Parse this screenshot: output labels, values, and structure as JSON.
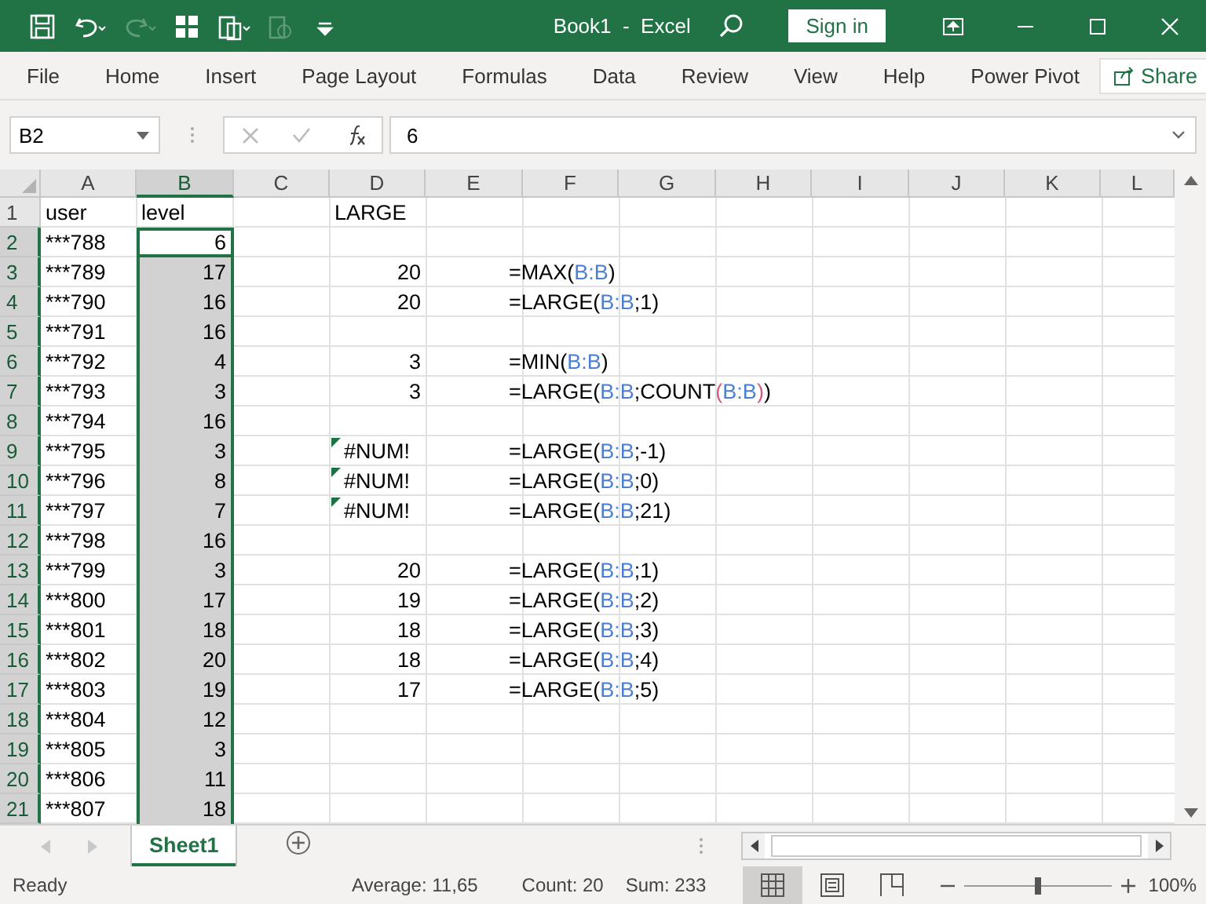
{
  "title_bar": {
    "quick_access": [
      {
        "kind": "save",
        "disabled": false
      },
      {
        "kind": "undo",
        "disabled": false
      },
      {
        "kind": "redo",
        "disabled": true
      },
      {
        "kind": "table",
        "disabled": false
      },
      {
        "kind": "paste",
        "disabled": false
      },
      {
        "kind": "paste_special",
        "disabled": true
      },
      {
        "kind": "customize",
        "disabled": false
      }
    ],
    "title": "Book1  -  Excel",
    "sign_in": "Sign in"
  },
  "ribbon_tabs": [
    {
      "label": "File"
    },
    {
      "label": "Home"
    },
    {
      "label": "Insert"
    },
    {
      "label": "Page Layout"
    },
    {
      "label": "Formulas"
    },
    {
      "label": "Data"
    },
    {
      "label": "Review"
    },
    {
      "label": "View"
    },
    {
      "label": "Help"
    },
    {
      "label": "Power Pivot"
    }
  ],
  "share": "Share",
  "formula_bar": {
    "name_box": "B2",
    "value": "6"
  },
  "columns": [
    {
      "label": "A",
      "selected": false
    },
    {
      "label": "B",
      "selected": true
    },
    {
      "label": "C",
      "selected": false
    },
    {
      "label": "D",
      "selected": false
    },
    {
      "label": "E",
      "selected": false
    },
    {
      "label": "F",
      "selected": false
    },
    {
      "label": "G",
      "selected": false
    },
    {
      "label": "H",
      "selected": false
    },
    {
      "label": "I",
      "selected": false
    },
    {
      "label": "J",
      "selected": false
    },
    {
      "label": "K",
      "selected": false
    },
    {
      "label": "L",
      "selected": false
    }
  ],
  "rows": [
    {
      "number": "1",
      "selected": false,
      "column_a": {
        "kind": "text",
        "text": "user"
      },
      "column_b": {
        "kind": "text",
        "text": "level",
        "selected": false
      },
      "column_d": {
        "kind": "text",
        "text": "LARGE"
      }
    },
    {
      "number": "2",
      "selected": true,
      "column_a": {
        "kind": "text",
        "text": "***788"
      },
      "column_b": {
        "kind": "number",
        "text": "6",
        "active": true
      }
    },
    {
      "number": "3",
      "selected": true,
      "column_a": {
        "kind": "text",
        "text": "***789"
      },
      "column_b": {
        "kind": "number",
        "text": "17",
        "selected": true
      },
      "column_d": {
        "kind": "number",
        "text": "20"
      },
      "column_f": {
        "kind": "formula",
        "segments": [
          {
            "text": "=MAX(",
            "color": "#000000"
          },
          {
            "text": "B:B",
            "color": "#4a7fd4"
          },
          {
            "text": ")",
            "color": "#000000"
          }
        ]
      }
    },
    {
      "number": "4",
      "selected": true,
      "column_a": {
        "kind": "text",
        "text": "***790"
      },
      "column_b": {
        "kind": "number",
        "text": "16",
        "selected": true
      },
      "column_d": {
        "kind": "number",
        "text": "20"
      },
      "column_f": {
        "kind": "formula",
        "segments": [
          {
            "text": "=LARGE(",
            "color": "#000000"
          },
          {
            "text": "B:B",
            "color": "#4a7fd4"
          },
          {
            "text": ";1)",
            "color": "#000000"
          }
        ]
      }
    },
    {
      "number": "5",
      "selected": true,
      "column_a": {
        "kind": "text",
        "text": "***791"
      },
      "column_b": {
        "kind": "number",
        "text": "16",
        "selected": true
      }
    },
    {
      "number": "6",
      "selected": true,
      "column_a": {
        "kind": "text",
        "text": "***792"
      },
      "column_b": {
        "kind": "number",
        "text": "4",
        "selected": true
      },
      "column_d": {
        "kind": "number",
        "text": "3"
      },
      "column_f": {
        "kind": "formula",
        "segments": [
          {
            "text": "=MIN(",
            "color": "#000000"
          },
          {
            "text": "B:B",
            "color": "#4a7fd4"
          },
          {
            "text": ")",
            "color": "#000000"
          }
        ]
      }
    },
    {
      "number": "7",
      "selected": true,
      "column_a": {
        "kind": "text",
        "text": "***793"
      },
      "column_b": {
        "kind": "number",
        "text": "3",
        "selected": true
      },
      "column_d": {
        "kind": "number",
        "text": "3"
      },
      "column_f": {
        "kind": "formula",
        "segments": [
          {
            "text": "=LARGE(",
            "color": "#000000"
          },
          {
            "text": "B:B",
            "color": "#4a7fd4"
          },
          {
            "text": ";COUNT",
            "color": "#000000"
          },
          {
            "text": "(",
            "color": "#d35b83"
          },
          {
            "text": "B:B",
            "color": "#4a7fd4"
          },
          {
            "text": ")",
            "color": "#d35b83"
          },
          {
            "text": ")",
            "color": "#000000"
          }
        ]
      }
    },
    {
      "number": "8",
      "selected": true,
      "column_a": {
        "kind": "text",
        "text": "***794"
      },
      "column_b": {
        "kind": "number",
        "text": "16",
        "selected": true
      }
    },
    {
      "number": "9",
      "selected": true,
      "column_a": {
        "kind": "text",
        "text": "***795"
      },
      "column_b": {
        "kind": "number",
        "text": "3",
        "selected": true
      },
      "column_d": {
        "kind": "error",
        "text": "#NUM!"
      },
      "column_f": {
        "kind": "formula",
        "segments": [
          {
            "text": "=LARGE(",
            "color": "#000000"
          },
          {
            "text": "B:B",
            "color": "#4a7fd4"
          },
          {
            "text": ";-1)",
            "color": "#000000"
          }
        ]
      }
    },
    {
      "number": "10",
      "selected": true,
      "column_a": {
        "kind": "text",
        "text": "***796"
      },
      "column_b": {
        "kind": "number",
        "text": "8",
        "selected": true
      },
      "column_d": {
        "kind": "error",
        "text": "#NUM!"
      },
      "column_f": {
        "kind": "formula",
        "segments": [
          {
            "text": "=LARGE(",
            "color": "#000000"
          },
          {
            "text": "B:B",
            "color": "#4a7fd4"
          },
          {
            "text": ";0)",
            "color": "#000000"
          }
        ]
      }
    },
    {
      "number": "11",
      "selected": true,
      "column_a": {
        "kind": "text",
        "text": "***797"
      },
      "column_b": {
        "kind": "number",
        "text": "7",
        "selected": true
      },
      "column_d": {
        "kind": "error",
        "text": "#NUM!"
      },
      "column_f": {
        "kind": "formula",
        "segments": [
          {
            "text": "=LARGE(",
            "color": "#000000"
          },
          {
            "text": "B:B",
            "color": "#4a7fd4"
          },
          {
            "text": ";21)",
            "color": "#000000"
          }
        ]
      }
    },
    {
      "number": "12",
      "selected": true,
      "column_a": {
        "kind": "text",
        "text": "***798"
      },
      "column_b": {
        "kind": "number",
        "text": "16",
        "selected": true
      }
    },
    {
      "number": "13",
      "selected": true,
      "column_a": {
        "kind": "text",
        "text": "***799"
      },
      "column_b": {
        "kind": "number",
        "text": "3",
        "selected": true
      },
      "column_d": {
        "kind": "number",
        "text": "20"
      },
      "column_f": {
        "kind": "formula",
        "segments": [
          {
            "text": "=LARGE(",
            "color": "#000000"
          },
          {
            "text": "B:B",
            "color": "#4a7fd4"
          },
          {
            "text": ";1)",
            "color": "#000000"
          }
        ]
      }
    },
    {
      "number": "14",
      "selected": true,
      "column_a": {
        "kind": "text",
        "text": "***800"
      },
      "column_b": {
        "kind": "number",
        "text": "17",
        "selected": true
      },
      "column_d": {
        "kind": "number",
        "text": "19"
      },
      "column_f": {
        "kind": "formula",
        "segments": [
          {
            "text": "=LARGE(",
            "color": "#000000"
          },
          {
            "text": "B:B",
            "color": "#4a7fd4"
          },
          {
            "text": ";2)",
            "color": "#000000"
          }
        ]
      }
    },
    {
      "number": "15",
      "selected": true,
      "column_a": {
        "kind": "text",
        "text": "***801"
      },
      "column_b": {
        "kind": "number",
        "text": "18",
        "selected": true
      },
      "column_d": {
        "kind": "number",
        "text": "18"
      },
      "column_f": {
        "kind": "formula",
        "segments": [
          {
            "text": "=LARGE(",
            "color": "#000000"
          },
          {
            "text": "B:B",
            "color": "#4a7fd4"
          },
          {
            "text": ";3)",
            "color": "#000000"
          }
        ]
      }
    },
    {
      "number": "16",
      "selected": true,
      "column_a": {
        "kind": "text",
        "text": "***802"
      },
      "column_b": {
        "kind": "number",
        "text": "20",
        "selected": true
      },
      "column_d": {
        "kind": "number",
        "text": "18"
      },
      "column_f": {
        "kind": "formula",
        "segments": [
          {
            "text": "=LARGE(",
            "color": "#000000"
          },
          {
            "text": "B:B",
            "color": "#4a7fd4"
          },
          {
            "text": ";4)",
            "color": "#000000"
          }
        ]
      }
    },
    {
      "number": "17",
      "selected": true,
      "column_a": {
        "kind": "text",
        "text": "***803"
      },
      "column_b": {
        "kind": "number",
        "text": "19",
        "selected": true
      },
      "column_d": {
        "kind": "number",
        "text": "17"
      },
      "column_f": {
        "kind": "formula",
        "segments": [
          {
            "text": "=LARGE(",
            "color": "#000000"
          },
          {
            "text": "B:B",
            "color": "#4a7fd4"
          },
          {
            "text": ";5)",
            "color": "#000000"
          }
        ]
      }
    },
    {
      "number": "18",
      "selected": true,
      "column_a": {
        "kind": "text",
        "text": "***804"
      },
      "column_b": {
        "kind": "number",
        "text": "12",
        "selected": true
      }
    },
    {
      "number": "19",
      "selected": true,
      "column_a": {
        "kind": "text",
        "text": "***805"
      },
      "column_b": {
        "kind": "number",
        "text": "3",
        "selected": true
      }
    },
    {
      "number": "20",
      "selected": true,
      "column_a": {
        "kind": "text",
        "text": "***806"
      },
      "column_b": {
        "kind": "number",
        "text": "11",
        "selected": true
      }
    },
    {
      "number": "21",
      "selected": true,
      "column_a": {
        "kind": "text",
        "text": "***807"
      },
      "column_b": {
        "kind": "number",
        "text": "18",
        "selected": true
      }
    }
  ],
  "sheet_tabs": [
    {
      "label": "Sheet1",
      "selected": true
    }
  ],
  "status_bar": {
    "mode": "Ready",
    "average": "Average: 11,65",
    "count": "Count: 20",
    "sum": "Sum: 233",
    "views": [
      {
        "kind": "normal",
        "selected": true
      },
      {
        "kind": "page_layout",
        "selected": false
      },
      {
        "kind": "page_break",
        "selected": false
      }
    ],
    "zoom": {
      "level": 0.5,
      "reading": "100%"
    }
  }
}
